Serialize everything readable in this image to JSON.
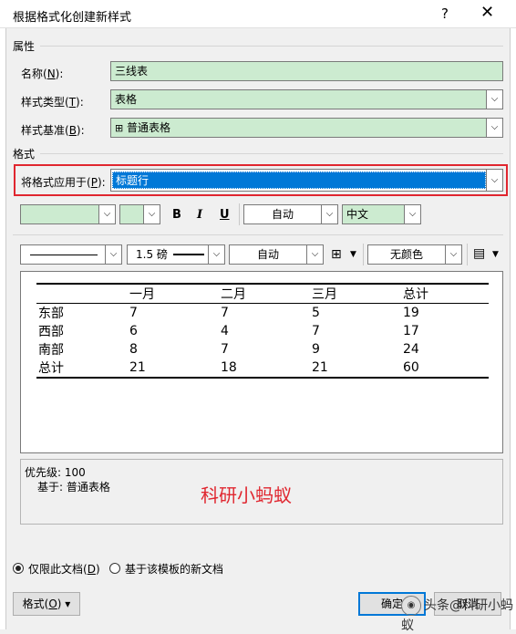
{
  "dialog": {
    "title": "根据格式化创建新样式",
    "help_label": "?",
    "close_label": "✕"
  },
  "properties": {
    "section_label": "属性",
    "name": {
      "label": "名称(",
      "hotkey": "N",
      "tail": "):",
      "value": "三线表"
    },
    "style_type": {
      "label": "样式类型(",
      "hotkey": "T",
      "tail": "):",
      "value": "表格"
    },
    "style_based_on": {
      "label": "样式基准(",
      "hotkey": "B",
      "tail": "):",
      "value": "普通表格",
      "icon": "table-grid-icon"
    }
  },
  "format": {
    "section_label": "格式",
    "apply_to": {
      "label": "将格式应用于(",
      "hotkey": "P",
      "tail": "):",
      "value": "标题行"
    },
    "font_row": {
      "bold": "B",
      "italic": "I",
      "underline": "U",
      "color_value": "自动",
      "script_value": "中文"
    },
    "border_row": {
      "weight_value": "1.5 磅",
      "border_color_value": "自动",
      "shading_value": "无颜色"
    }
  },
  "preview": {
    "headers": [
      "",
      "一月",
      "二月",
      "三月",
      "总计"
    ],
    "rows": [
      [
        "东部",
        "7",
        "7",
        "5",
        "19"
      ],
      [
        "西部",
        "6",
        "4",
        "7",
        "17"
      ],
      [
        "南部",
        "8",
        "7",
        "9",
        "24"
      ],
      [
        "总计",
        "21",
        "18",
        "21",
        "60"
      ]
    ]
  },
  "description": {
    "priority": "优先级: 100",
    "based_on": "基于: 普通表格"
  },
  "watermark": {
    "red_text": "科研小蚂蚁",
    "footer_text": "头条@科研小蚂蚁"
  },
  "scope": {
    "this_doc": {
      "label": "仅限此文档(",
      "hotkey": "D",
      "tail": ")",
      "checked": true
    },
    "new_docs": {
      "label": "基于该模板的新文档",
      "checked": false
    }
  },
  "buttons": {
    "format": {
      "label": "格式(",
      "hotkey": "O",
      "tail": ") ▾"
    },
    "ok": "确定",
    "cancel": "取消"
  },
  "colors": {
    "field_fill": "#ccebd0",
    "highlight": "#0078d7",
    "annotation_red": "#e0262f"
  }
}
